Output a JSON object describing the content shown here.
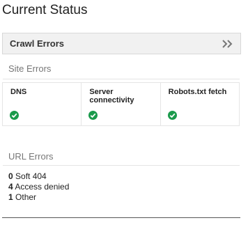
{
  "page": {
    "title": "Current Status"
  },
  "panel": {
    "label": "Crawl Errors",
    "expand_icon": "double-chevron-right-icon"
  },
  "site_errors": {
    "heading": "Site Errors",
    "items": [
      {
        "label": "DNS",
        "status": "ok",
        "icon": "check-circle-icon"
      },
      {
        "label": "Server connectivity",
        "status": "ok",
        "icon": "check-circle-icon"
      },
      {
        "label": "Robots.txt fetch",
        "status": "ok",
        "icon": "check-circle-icon"
      }
    ]
  },
  "url_errors": {
    "heading": "URL Errors",
    "items": [
      {
        "count": "0",
        "label": "Soft 404"
      },
      {
        "count": "4",
        "label": "Access denied"
      },
      {
        "count": "1",
        "label": "Other"
      }
    ]
  },
  "colors": {
    "ok": "#1a9a4b",
    "header_bg": "#f1f1f1",
    "muted_text": "#777777"
  }
}
